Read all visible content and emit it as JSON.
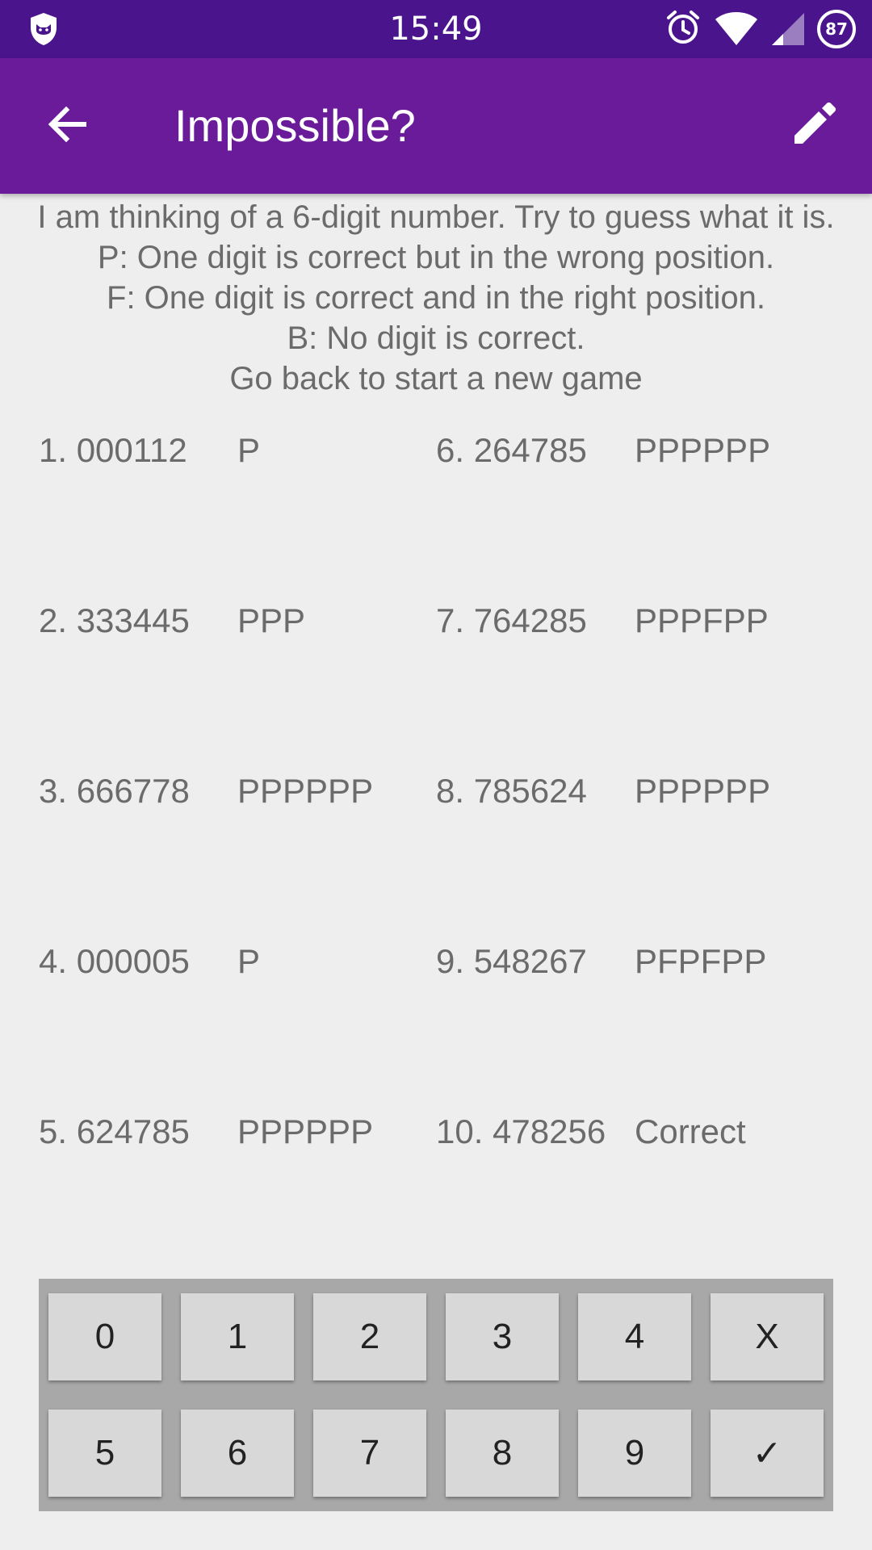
{
  "status_bar": {
    "time": "15:49",
    "battery": "87",
    "icons": [
      "shield-icon",
      "alarm-icon",
      "wifi-icon",
      "signal-icon",
      "battery-icon"
    ]
  },
  "app_bar": {
    "title": "Impossible?",
    "back_icon": "arrow-back-icon",
    "edit_icon": "pencil-icon",
    "background": "#6a1b9a",
    "status_background": "#4a148c"
  },
  "instructions": [
    "I am thinking of a 6-digit number. Try to guess what it is.",
    "P: One digit is correct but in the wrong position.",
    "F: One digit is correct and in the right position.",
    "B: No digit is correct.",
    "Go back to start a new game"
  ],
  "guesses": [
    {
      "number": "1. 000112",
      "result": "P"
    },
    {
      "number": "2. 333445",
      "result": "PPP"
    },
    {
      "number": "3. 666778",
      "result": "PPPPPP"
    },
    {
      "number": "4. 000005",
      "result": "P"
    },
    {
      "number": "5. 624785",
      "result": "PPPPPP"
    },
    {
      "number": "6. 264785",
      "result": "PPPPPP"
    },
    {
      "number": "7. 764285",
      "result": "PPPFPP"
    },
    {
      "number": "8. 785624",
      "result": "PPPPPP"
    },
    {
      "number": "9. 548267",
      "result": "PFPFPP"
    },
    {
      "number": "10. 478256",
      "result": "Correct"
    }
  ],
  "keypad": {
    "row1": [
      "0",
      "1",
      "2",
      "3",
      "4",
      "X"
    ],
    "row2": [
      "5",
      "6",
      "7",
      "8",
      "9",
      "✓"
    ]
  }
}
